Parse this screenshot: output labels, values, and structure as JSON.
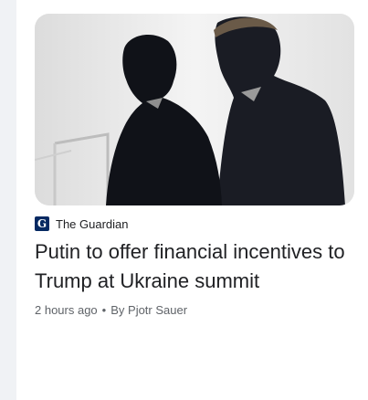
{
  "article": {
    "image_alt": "Silhouettes of Putin and Trump",
    "source": {
      "logo_letter": "G",
      "name": "The Guardian"
    },
    "headline": "Putin to offer financial incentives to Trump at Ukraine summit",
    "time_ago": "2 hours ago",
    "separator": "•",
    "byline": "By Pjotr Sauer"
  },
  "colors": {
    "source_logo_bg": "#052962",
    "headline": "#202124",
    "meta": "#5f6368",
    "rail": "#f0f2f5"
  },
  "icons": {
    "source_logo": "guardian-logo-icon"
  }
}
